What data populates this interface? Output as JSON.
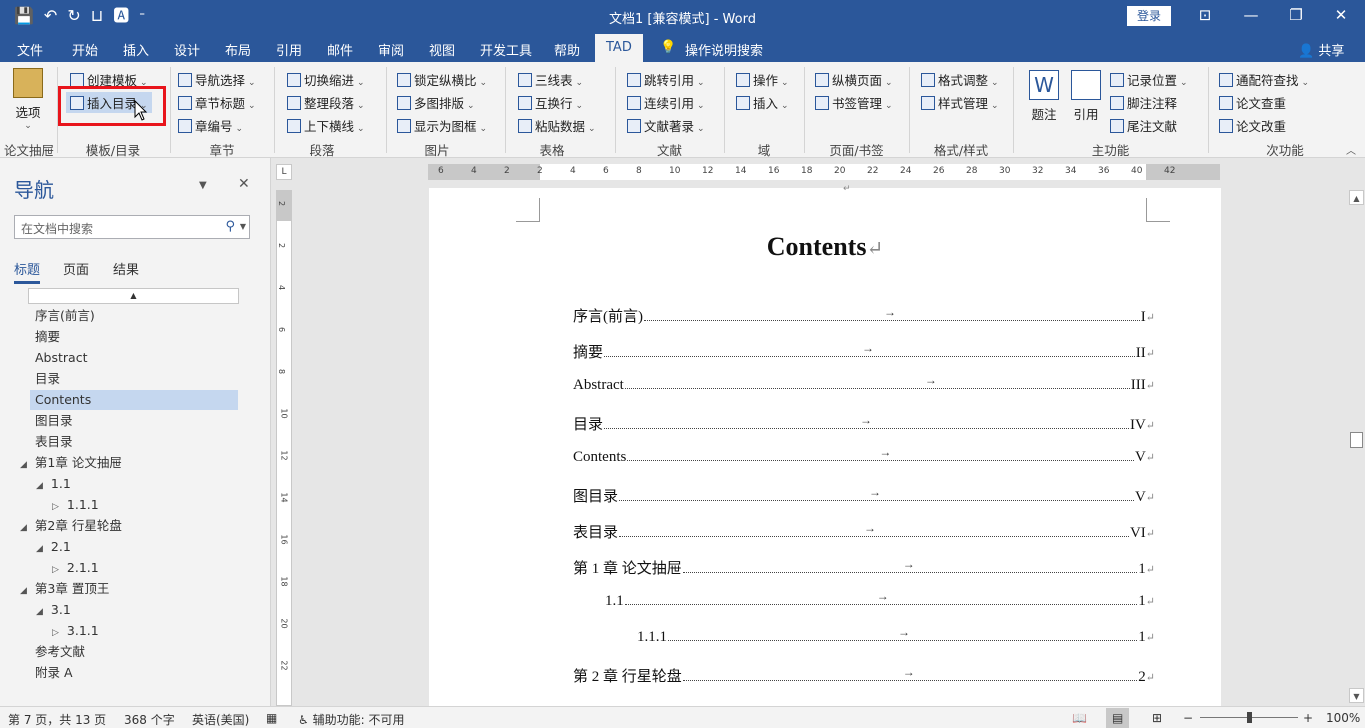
{
  "titlebar": {
    "title": "文档1 [兼容模式]  -  Word",
    "login": "登录",
    "qat_icons": [
      "save-icon",
      "undo-icon",
      "redo-icon",
      "format-painter-icon",
      "customize-icon"
    ]
  },
  "menu": {
    "tabs": [
      "文件",
      "开始",
      "插入",
      "设计",
      "布局",
      "引用",
      "邮件",
      "审阅",
      "视图",
      "开发工具",
      "帮助",
      "TAD"
    ],
    "active_tab": "TAD",
    "tell_me": "操作说明搜索",
    "share": "共享"
  },
  "ribbon": {
    "options": "选项",
    "groups": [
      "论文抽屉",
      "模板/目录",
      "章节",
      "段落",
      "图片",
      "表格",
      "文献",
      "域",
      "页面/书签",
      "格式/样式",
      "主功能",
      "次功能"
    ],
    "template": {
      "create": "创建模板",
      "insert_toc": "插入目录"
    },
    "chapter": {
      "nav": "导航选择",
      "heading": "章节标题",
      "number": "章编号"
    },
    "paragraph": {
      "indent": "切换缩进",
      "tidy": "整理段落",
      "lines": "上下横线"
    },
    "picture": {
      "lock": "锁定纵横比",
      "multi": "多图排版",
      "frame": "显示为图框"
    },
    "table": {
      "three_line": "三线表",
      "swap": "互换行",
      "paste": "粘贴数据"
    },
    "reference": {
      "jump": "跳转引用",
      "continuous": "连续引用",
      "bib": "文献著录"
    },
    "field": {
      "op": "操作",
      "insert": "插入"
    },
    "page": {
      "orientation": "纵横页面",
      "bookmark": "书签管理"
    },
    "format": {
      "adjust": "格式调整",
      "style": "样式管理"
    },
    "main": {
      "caption": "题注",
      "cite": "引用",
      "record": "记录位置",
      "footnote": "脚注注释",
      "endnote": "尾注文献"
    },
    "secondary": {
      "wildcard": "通配符查找",
      "check": "论文查重",
      "revise": "论文改重"
    }
  },
  "nav": {
    "title": "导航",
    "search_placeholder": "在文档中搜索",
    "tabs": [
      "标题",
      "页面",
      "结果"
    ],
    "active_tab": "标题",
    "headings": [
      {
        "label": "序言(前言)",
        "level": 1,
        "toggle": ""
      },
      {
        "label": "摘要",
        "level": 1,
        "toggle": ""
      },
      {
        "label": "Abstract",
        "level": 1,
        "toggle": ""
      },
      {
        "label": "目录",
        "level": 1,
        "toggle": ""
      },
      {
        "label": "Contents",
        "level": 1,
        "toggle": "",
        "selected": true
      },
      {
        "label": "图目录",
        "level": 1,
        "toggle": ""
      },
      {
        "label": "表目录",
        "level": 1,
        "toggle": ""
      },
      {
        "label": "第1章 论文抽屉",
        "level": 1,
        "toggle": "◢"
      },
      {
        "label": "1.1",
        "level": 2,
        "toggle": "◢"
      },
      {
        "label": "1.1.1",
        "level": 3,
        "toggle": "▷"
      },
      {
        "label": "第2章 行星轮盘",
        "level": 1,
        "toggle": "◢"
      },
      {
        "label": "2.1",
        "level": 2,
        "toggle": "◢"
      },
      {
        "label": "2.1.1",
        "level": 3,
        "toggle": "▷"
      },
      {
        "label": "第3章 置顶王",
        "level": 1,
        "toggle": "◢"
      },
      {
        "label": "3.1",
        "level": 2,
        "toggle": "◢"
      },
      {
        "label": "3.1.1",
        "level": 3,
        "toggle": "▷"
      },
      {
        "label": "参考文献",
        "level": 1,
        "toggle": ""
      },
      {
        "label": "附录 A",
        "level": 1,
        "toggle": ""
      }
    ]
  },
  "ruler": {
    "horizontal": [
      "6",
      "4",
      "2",
      "2",
      "4",
      "6",
      "8",
      "10",
      "12",
      "14",
      "16",
      "18",
      "20",
      "22",
      "24",
      "26",
      "28",
      "30",
      "32",
      "34",
      "36",
      "40",
      "42"
    ],
    "vertical": [
      "2",
      "2",
      "4",
      "6",
      "8",
      "10",
      "12",
      "14",
      "16",
      "18",
      "20",
      "22"
    ]
  },
  "document": {
    "title": "Contents",
    "paragraph_mark": "↵",
    "toc": [
      {
        "label": "序言(前言)",
        "page": "I",
        "indent": 0
      },
      {
        "label": "摘要",
        "page": "II",
        "indent": 0
      },
      {
        "label": "Abstract",
        "page": "III",
        "indent": 0
      },
      {
        "label": "目录",
        "page": "IV",
        "indent": 0
      },
      {
        "label": "Contents",
        "page": "V",
        "indent": 0
      },
      {
        "label": "图目录",
        "page": "V",
        "indent": 0
      },
      {
        "label": "表目录",
        "page": "VI",
        "indent": 0
      },
      {
        "label": "第 1 章 论文抽屉",
        "page": "1",
        "indent": 0
      },
      {
        "label": "1.1",
        "page": "1",
        "indent": 1
      },
      {
        "label": "1.1.1",
        "page": "1",
        "indent": 2
      },
      {
        "label": "第 2 章 行星轮盘",
        "page": "2",
        "indent": 0
      }
    ]
  },
  "status": {
    "page": "第 7 页，共 13 页",
    "words": "368 个字",
    "language": "英语(美国)",
    "accessibility": "辅助功能: 不可用",
    "zoom": "100%"
  },
  "colors": {
    "accent": "#2b579a",
    "highlight": "#e8141b",
    "selected": "#c5d7ef"
  }
}
